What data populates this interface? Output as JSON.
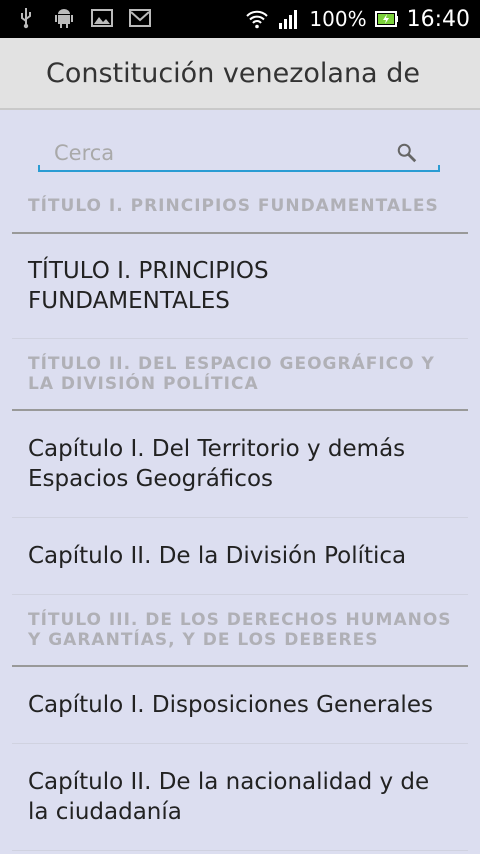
{
  "status_bar": {
    "battery": "100%",
    "time": "16:40",
    "left_icons": [
      "usb-icon",
      "android-icon",
      "image-icon",
      "mail-icon"
    ],
    "right_icons": [
      "wifi-icon",
      "signal-icon",
      "battery-icon"
    ]
  },
  "action_bar": {
    "title": "Constitución venezolana de"
  },
  "search": {
    "placeholder": "Cerca",
    "accent": "#2a9cd3"
  },
  "list": {
    "section_1": "TÍTULO I. PRINCIPIOS FUNDAMENTALES",
    "item_1": "TÍTULO I. PRINCIPIOS FUNDAMENTALES",
    "section_2": "TÍTULO II. DEL ESPACIO GEOGRÁFICO Y LA DIVISIÓN POLÍTICA",
    "item_2": "Capítulo I. Del Territorio y demás Espacios Geográficos",
    "item_3": "Capítulo II. De la División Política",
    "section_3": "TÍTULO III. DE LOS DERECHOS HUMANOS Y GARANTÍAS, Y DE LOS DEBERES",
    "item_4": "Capítulo I. Disposiciones Generales",
    "item_5": "Capítulo II. De la nacionalidad y de la ciudadanía"
  }
}
